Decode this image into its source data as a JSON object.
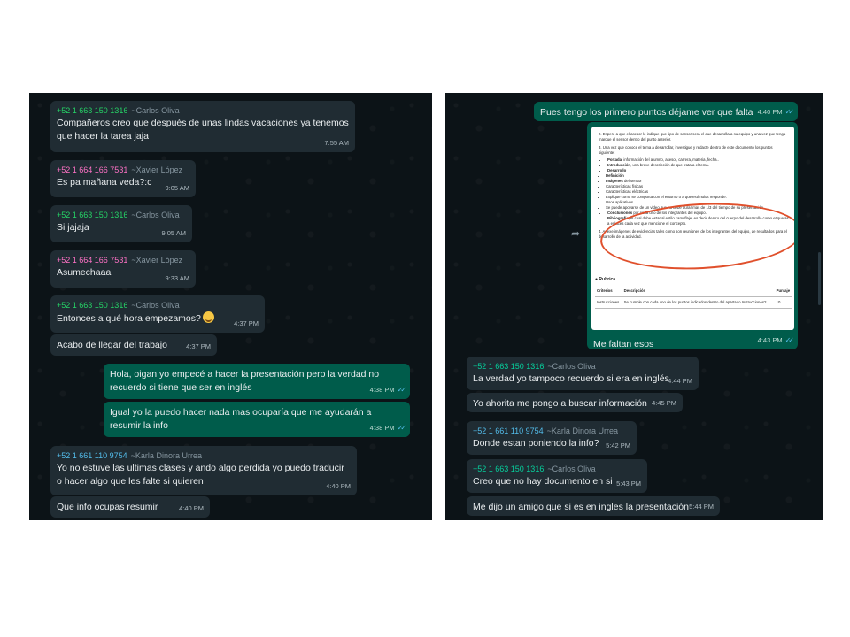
{
  "left_chat": {
    "messages": [
      {
        "sender_number": "+52 1 663 150 1316",
        "sender_alias": "~Carlos Oliva",
        "text": "Compañeros creo que después de unas lindas vacaciones ya tenemos que hacer la tarea jaja",
        "time": "7:55 AM"
      },
      {
        "sender_number": "+52 1 664 166 7531",
        "sender_alias": "~Xavier López",
        "text": "Es pa mañana veda?:c",
        "time": "9:05 AM"
      },
      {
        "sender_number": "+52 1 663 150 1316",
        "sender_alias": "~Carlos Oliva",
        "text": "Si jajaja",
        "time": "9:05 AM"
      },
      {
        "sender_number": "+52 1 664 166 7531",
        "sender_alias": "~Xavier López",
        "text": "Asumechaaa",
        "time": "9:33 AM"
      },
      {
        "sender_number": "+52 1 663 150 1316",
        "sender_alias": "~Carlos Oliva",
        "text": "Entonces a qué hora empezamos?",
        "time": "4:37 PM",
        "emoji": "grinning-sweat-emoji"
      },
      {
        "text": "Acabo de llegar del trabajo",
        "time": "4:37 PM"
      },
      {
        "text": "Hola, oigan yo empecé a hacer la presentación pero la verdad no recuerdo si tiene que ser en inglés",
        "time": "4:38 PM"
      },
      {
        "text": "Igual yo la puedo hacer nada mas ocuparía que me ayudarán a resumir la info",
        "time": "4:38 PM"
      },
      {
        "sender_number": "+52 1 661 110 9754",
        "sender_alias": "~Karla Dinora Urrea",
        "text": "Yo no estuve las ultimas clases y ando algo perdida yo puedo traducir o hacer algo que les falte si quieren",
        "time": "4:40 PM"
      },
      {
        "text": "Que info ocupas resumir",
        "time": "4:40 PM"
      }
    ]
  },
  "right_chat": {
    "messages": [
      {
        "text": "Pues tengo los primero puntos déjame ver que falta",
        "time": "4:40 PM"
      },
      {
        "caption": "Me faltan esos",
        "time": "4:43 PM"
      },
      {
        "sender_number": "+52 1 663 150 1316",
        "sender_alias": "~Carlos Oliva",
        "text": "La verdad yo tampoco recuerdo si era en inglés",
        "time": "4:44 PM"
      },
      {
        "text": "Yo ahorita me pongo a buscar información",
        "time": "4:45 PM"
      },
      {
        "sender_number": "+52 1 661 110 9754",
        "sender_alias": "~Karla Dinora Urrea",
        "text": "Donde estan poniendo la info?",
        "time": "5:42 PM"
      },
      {
        "sender_number": "+52 1 663 150 1316",
        "sender_alias": "~Carlos Oliva",
        "text": "Creo que no hay documento en si",
        "time": "5:43 PM"
      },
      {
        "text": "Me dijo un amigo que si es en ingles la presentación",
        "time": "5:44 PM"
      }
    ],
    "document_image": {
      "lines": [
        "2. Espere a que el asesor le indique que tipo de sensor sera el que desarrollara su equipo y una vez que tenga marque el sensor dentro del punto anterior.",
        "3. Una vez que conoce el tema a desarrollar, investigue y redacte dentro de este documento los puntos siguiente:"
      ],
      "bullets": [
        {
          "bold": "Portada",
          "rest": ", información del alumno, asesor, carrera, materia, fecha.."
        },
        {
          "bold": "Introducción",
          "rest": ", una breve descripción de que tratara el tema."
        },
        {
          "bold": "Desarrollo",
          "rest": ""
        }
      ],
      "sub_bullets": [
        {
          "bold": "Definición",
          "rest": ""
        },
        {
          "bold": "Imágenes",
          "rest": " del sensor"
        },
        {
          "bold": "",
          "rest": "Características físicas"
        },
        {
          "bold": "",
          "rest": "Características eléctricas"
        },
        {
          "bold": "",
          "rest": "Explique como se comporta con el entorno o a que estímulos responde."
        },
        {
          "bold": "",
          "rest": "Usos aplicativos"
        },
        {
          "bold": "",
          "rest": "Se puede apoyarse de un video que no debe durar mas de 1/3 del tiempo de su presentación."
        }
      ],
      "bullets_after": [
        {
          "bold": "Conclusiones",
          "rest": " por cada uno de los integrantes del equipo."
        },
        {
          "bold": "Bibliografía",
          "rest": ", el cual debe estar al estilo camuflaje, es decir dentro del cuerpo del desarrollo como etiquetas a enlaces cada vez que mencione el concepto."
        }
      ],
      "footer_line": "4. Anexe imágenes de evidencias tales como son reuniones de los integrantes del equipo, de resultados para el desarrollo de la actividad.",
      "rubric_title": "Rubrica",
      "rubric_headers": [
        "Criterios",
        "Descripción",
        "Puntaje"
      ],
      "rubric_row": [
        "Instrucciones",
        "Se cumple con cada uno de los puntos indicados dentro del apartado Instrucciones?",
        "10"
      ]
    }
  },
  "colors": {
    "chat_background": "#0c1317",
    "incoming_bubble": "#202c33",
    "outgoing_bubble": "#005c4b",
    "text": "#e9edef",
    "read_check": "#53bdeb"
  }
}
